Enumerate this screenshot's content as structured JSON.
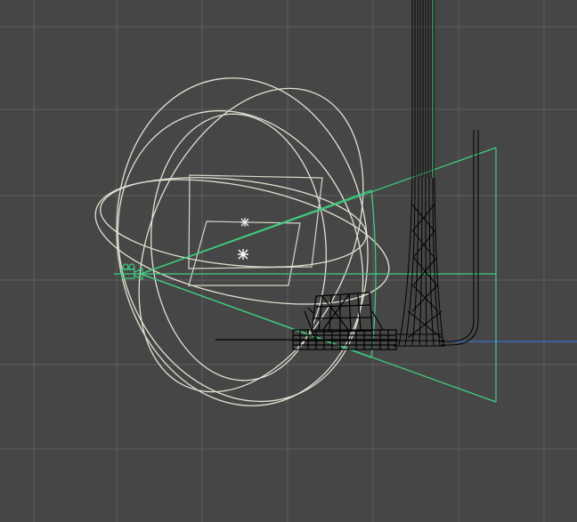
{
  "viewport": {
    "view": "wireframe",
    "colors": {
      "background": "#464646",
      "grid": "#5e5e5e",
      "gizmo": "#e2e0d2",
      "camera": "#3fcf7f",
      "geometry": "#000000",
      "axis": "#3b6fd6"
    },
    "icons": {
      "camera": "camera-icon",
      "light": "light-icon"
    }
  }
}
